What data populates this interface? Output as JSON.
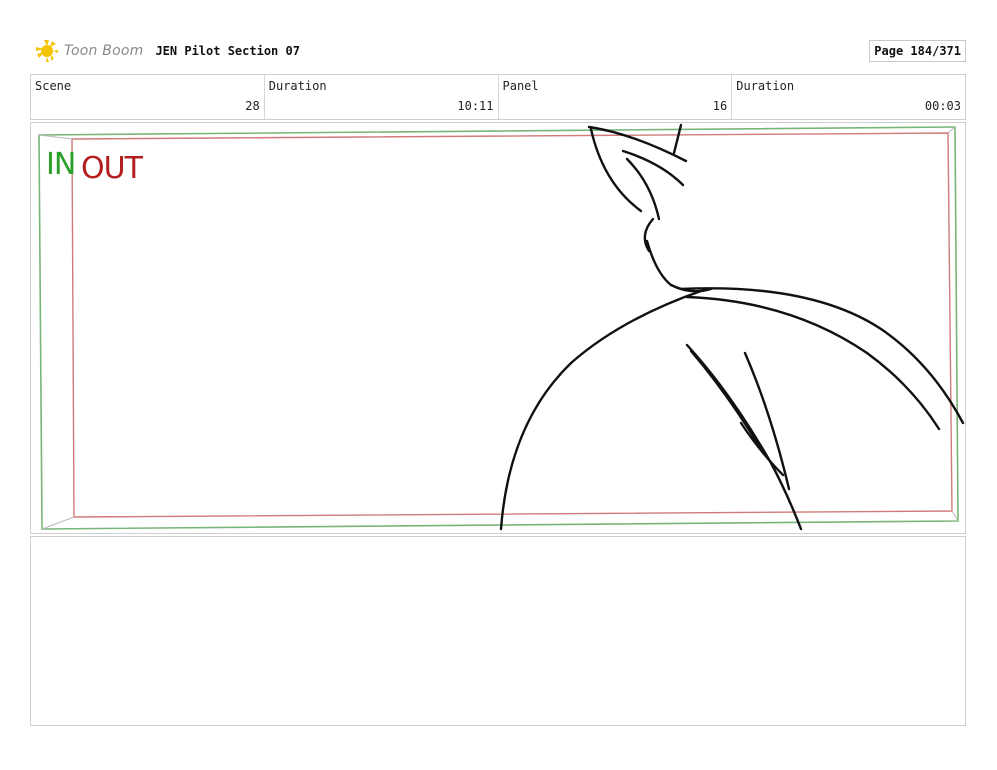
{
  "header": {
    "brand": "Toon Boom",
    "project_title": "JEN Pilot Section 07",
    "page_label": "Page 184/371"
  },
  "info": {
    "scene_label": "Scene",
    "scene_value": "28",
    "scene_duration_label": "Duration",
    "scene_duration_value": "10:11",
    "panel_label": "Panel",
    "panel_value": "16",
    "panel_duration_label": "Duration",
    "panel_duration_value": "00:03"
  },
  "frame": {
    "in_label": "IN",
    "out_label": "OUT",
    "in_color": "#2aa02a",
    "out_color": "#b41e1e"
  },
  "notes": {
    "text": ""
  }
}
